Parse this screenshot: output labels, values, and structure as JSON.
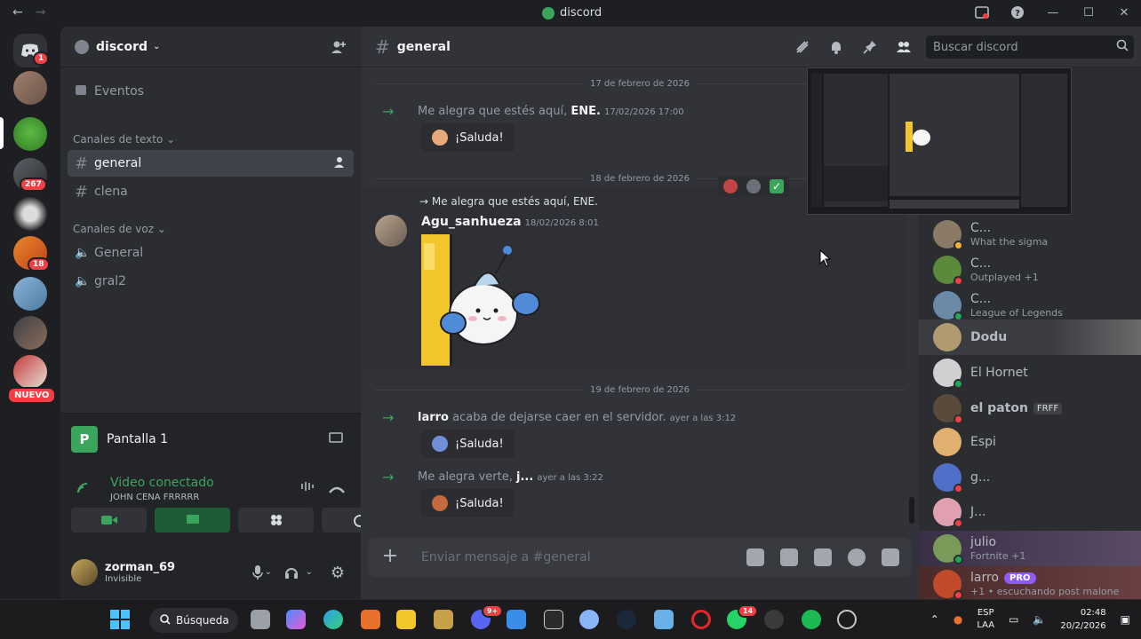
{
  "window": {
    "title": "discord",
    "search_placeholder": "Buscar discord"
  },
  "guild_badges": {
    "g1": "1",
    "g2": "267",
    "g3": "18",
    "nuevo": "NUEVO"
  },
  "sidebar": {
    "server_name": "discord",
    "events": "Eventos",
    "text_category": "Canales de texto",
    "text_channels": [
      "general",
      "clena"
    ],
    "voice_category": "Canales de voz",
    "voice_channels": [
      "General",
      "gral2"
    ]
  },
  "voice_panel": {
    "stream_title": "Pantalla 1",
    "status": "Video conectado",
    "channel": "JOHN CENA FRRRRR"
  },
  "user": {
    "name": "zorman_69",
    "status": "Invisible"
  },
  "chat": {
    "channel": "general",
    "date1": "17 de febrero de 2026",
    "msg1_text": "Me alegra que estés aquí,",
    "msg1_name": "ENE.",
    "msg1_time": "17/02/2026 17:00",
    "wave_label": "¡Saluda!",
    "date2": "18 de febrero de 2026",
    "reply_text": "Me alegra que estés aquí, ENE.",
    "msg2_author": "Agu_sanhueza",
    "msg2_time": "18/02/2026 8:01",
    "date3": "19 de febrero de 2026",
    "msg3_name": "larro",
    "msg3_text": "acaba de dejarse caer en el servidor.",
    "msg3_time": "ayer a las 3:12",
    "msg4_text": "Me alegra verte,",
    "msg4_name": "j...",
    "msg4_time": "ayer a las 3:22",
    "composer_placeholder": "Enviar mensaje a #general"
  },
  "members": [
    {
      "name": "C...",
      "activity": "What the sigma"
    },
    {
      "name": "C...",
      "activity": "Outplayed +1"
    },
    {
      "name": "C...",
      "activity": "League of Legends"
    },
    {
      "name": "Dodu",
      "activity": ""
    },
    {
      "name": "El Hornet",
      "activity": ""
    },
    {
      "name": "el paton",
      "tag": "FRFF",
      "activity": ""
    },
    {
      "name": "Espi",
      "activity": ""
    },
    {
      "name": "g...",
      "activity": ""
    },
    {
      "name": "J...",
      "activity": ""
    },
    {
      "name": "julio",
      "activity": "Fortnite +1"
    },
    {
      "name": "larro",
      "tag": "PRO",
      "activity": "+1 • escuchando post malone"
    }
  ],
  "taskbar": {
    "search": "Búsqueda",
    "lang1": "ESP",
    "lang2": "LAA",
    "time": "02:48",
    "date": "20/2/2026",
    "whatsapp_badge": "14",
    "discord_badge": "9+"
  }
}
